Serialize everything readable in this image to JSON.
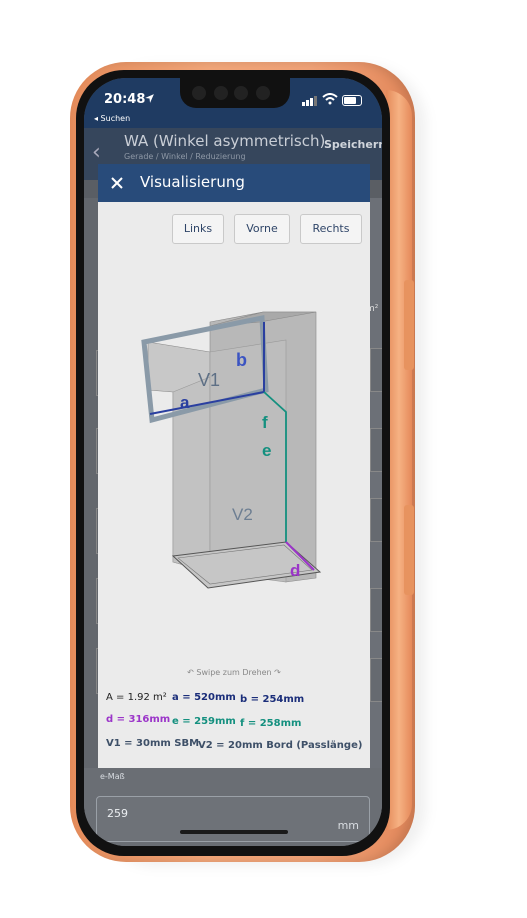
{
  "status_bar": {
    "time": "20:48",
    "back_app": "◂ Suchen"
  },
  "app_header": {
    "title": "WA (Winkel asymmetrisch)",
    "subtitle": "Gerade / Winkel / Reduzierung",
    "save": "Speichern"
  },
  "background": {
    "unit": "m²",
    "field_legend": "e-Maß",
    "field_value": "259",
    "field_unit": "mm"
  },
  "modal": {
    "title": "Visualisierung",
    "close_icon": "close-icon",
    "views": [
      "Links",
      "Vorne",
      "Rechts"
    ],
    "swipe_hint": "Swipe zum Drehen",
    "figure_labels": {
      "a": "a",
      "b": "b",
      "d": "d",
      "e": "e",
      "f": "f",
      "v1": "V1",
      "v2": "V2"
    },
    "dims": {
      "area": "A = 1.92 m²",
      "a": "a = 520mm",
      "b": "b = 254mm",
      "d": "d = 316mm",
      "e": "e = 259mm",
      "f": "f = 258mm",
      "v1": "V1 = 30mm SBM",
      "v2": "V2 = 20mm Bord (Passlänge)"
    }
  },
  "colors": {
    "header": "#284b7a",
    "dim_a": "#1b2e7a",
    "dim_d": "#9b35c9",
    "dim_e": "#14907f",
    "phone": "#f0a277"
  }
}
